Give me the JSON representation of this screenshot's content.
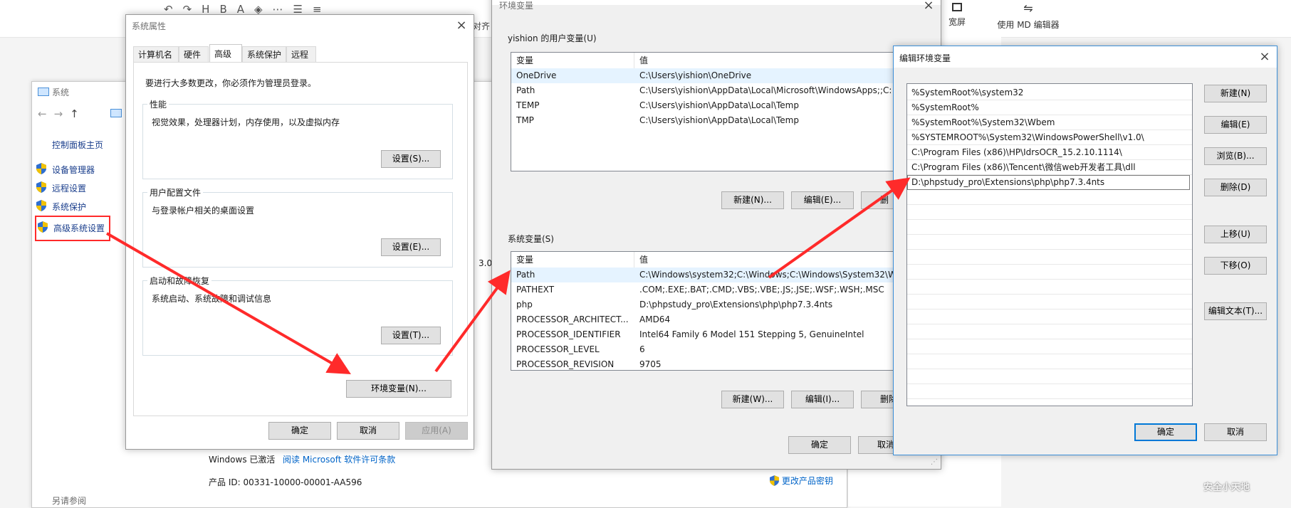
{
  "background": {
    "toolbar_right": {
      "widescreen": "宽屏",
      "md_editor": "使用 MD 编辑器"
    },
    "align_label": "对齐"
  },
  "system_window": {
    "title": "系统",
    "sidebar": {
      "home": "控制面板主页",
      "items": [
        "设备管理器",
        "远程设置",
        "系统保护",
        "高级系统设置"
      ]
    },
    "partial_text": "3.0",
    "activation": {
      "status": "Windows 已激活",
      "link": "阅读 Microsoft 软件许可条款"
    },
    "product_id": "产品 ID: 00331-10000-00001-AA596",
    "change_key": "更改产品密钥",
    "bottom_label": "另请参阅"
  },
  "sysprops": {
    "title": "系统属性",
    "tabs": [
      "计算机名",
      "硬件",
      "高级",
      "系统保护",
      "远程"
    ],
    "active_tab": 2,
    "admin_note": "要进行大多数更改，你必须作为管理员登录。",
    "groups": [
      {
        "label": "性能",
        "desc": "视觉效果，处理器计划，内存使用，以及虚拟内存",
        "button": "设置(S)..."
      },
      {
        "label": "用户配置文件",
        "desc": "与登录帐户相关的桌面设置",
        "button": "设置(E)..."
      },
      {
        "label": "启动和故障恢复",
        "desc": "系统启动、系统故障和调试信息",
        "button": "设置(T)..."
      }
    ],
    "env_button": "环境变量(N)...",
    "ok": "确定",
    "cancel": "取消",
    "apply": "应用(A)"
  },
  "envvars": {
    "title": "环境变量",
    "user_section": "yishion 的用户变量(U)",
    "col_var": "变量",
    "col_val": "值",
    "user_vars": [
      {
        "name": "OneDrive",
        "value": "C:\\Users\\yishion\\OneDrive"
      },
      {
        "name": "Path",
        "value": "C:\\Users\\yishion\\AppData\\Local\\Microsoft\\WindowsApps;;C:"
      },
      {
        "name": "TEMP",
        "value": "C:\\Users\\yishion\\AppData\\Local\\Temp"
      },
      {
        "name": "TMP",
        "value": "C:\\Users\\yishion\\AppData\\Local\\Temp"
      }
    ],
    "user_buttons": [
      "新建(N)...",
      "编辑(E)...",
      "删"
    ],
    "sys_section": "系统变量(S)",
    "sys_vars": [
      {
        "name": "Path",
        "value": "C:\\Windows\\system32;C:\\Windows;C:\\Windows\\System32\\W"
      },
      {
        "name": "PATHEXT",
        "value": ".COM;.EXE;.BAT;.CMD;.VBS;.VBE;.JS;.JSE;.WSF;.WSH;.MSC"
      },
      {
        "name": "php",
        "value": "D:\\phpstudy_pro\\Extensions\\php\\php7.3.4nts"
      },
      {
        "name": "PROCESSOR_ARCHITECT...",
        "value": "AMD64"
      },
      {
        "name": "PROCESSOR_IDENTIFIER",
        "value": "Intel64 Family 6 Model 151 Stepping 5, GenuineIntel"
      },
      {
        "name": "PROCESSOR_LEVEL",
        "value": "6"
      },
      {
        "name": "PROCESSOR_REVISION",
        "value": "9705"
      }
    ],
    "sys_buttons": [
      "新建(W)...",
      "编辑(I)...",
      "删除"
    ],
    "ok": "确定",
    "cancel": "取消"
  },
  "editenv": {
    "title": "编辑环境变量",
    "entries": [
      "%SystemRoot%\\system32",
      "%SystemRoot%",
      "%SystemRoot%\\System32\\Wbem",
      "%SYSTEMROOT%\\System32\\WindowsPowerShell\\v1.0\\",
      "C:\\Program Files (x86)\\HP\\IdrsOCR_15.2.10.1114\\",
      "C:\\Program Files (x86)\\Tencent\\微信web开发者工具\\dll",
      "D:\\phpstudy_pro\\Extensions\\php\\php7.3.4nts"
    ],
    "buttons": [
      "新建(N)",
      "编辑(E)",
      "浏览(B)...",
      "删除(D)",
      "上移(U)",
      "下移(O)",
      "编辑文本(T)..."
    ],
    "ok": "确定",
    "cancel": "取消"
  },
  "watermark": "安全小天地"
}
